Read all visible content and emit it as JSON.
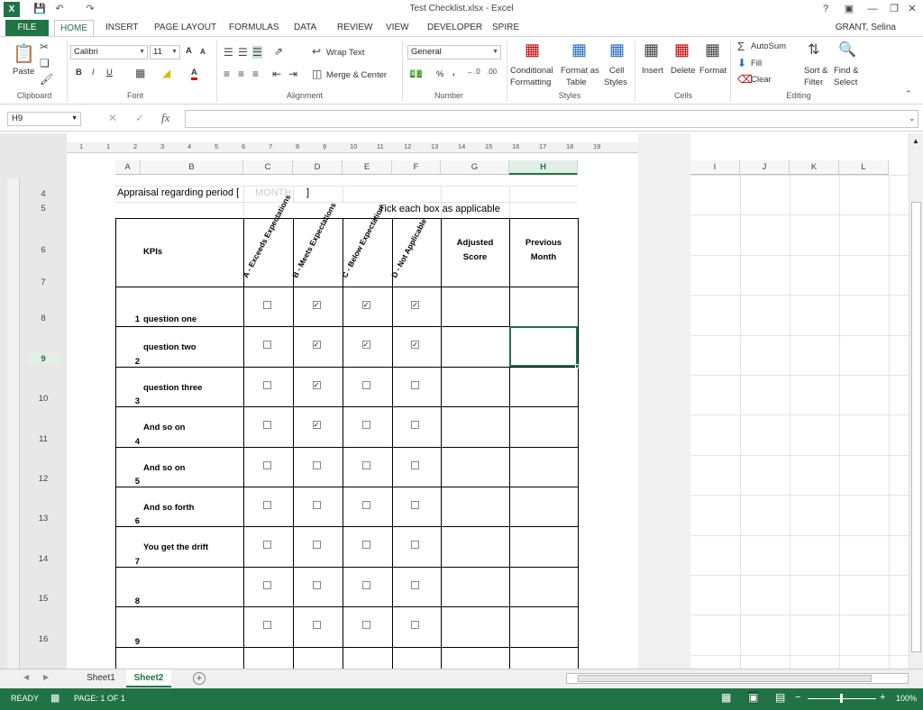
{
  "window": {
    "title": "Test Checklist.xlsx - Excel",
    "user": "GRANT, Selina",
    "help": "?",
    "logo": "X"
  },
  "tabs": [
    "FILE",
    "HOME",
    "INSERT",
    "PAGE LAYOUT",
    "FORMULAS",
    "DATA",
    "REVIEW",
    "VIEW",
    "DEVELOPER",
    "SPIRE"
  ],
  "ribbon": {
    "clipboard": {
      "paste": "Paste",
      "label": "Clipboard"
    },
    "font": {
      "name": "Calibri",
      "size": "11",
      "label": "Font",
      "bold": "B",
      "italic": "I",
      "underline": "U",
      "grow": "A",
      "shrink": "A",
      "fontcolor": "A"
    },
    "alignment": {
      "wrap": "Wrap Text",
      "merge": "Merge & Center",
      "label": "Alignment"
    },
    "number": {
      "format": "General",
      "label": "Number",
      "percent": "%",
      "comma": ","
    },
    "styles": {
      "conditional": "Conditional",
      "conditional2": "Formatting",
      "format_as": "Format as",
      "format_as2": "Table",
      "cell": "Cell",
      "cell2": "Styles",
      "label": "Styles"
    },
    "cells": {
      "insert": "Insert",
      "delete": "Delete",
      "format": "Format",
      "label": "Cells"
    },
    "editing": {
      "autosum": "AutoSum",
      "fill": "Fill",
      "clear": "Clear",
      "sort": "Sort &",
      "sort2": "Filter",
      "find": "Find &",
      "find2": "Select",
      "label": "Editing"
    }
  },
  "formula_bar": {
    "name_box": "H9",
    "fx": "fx",
    "value": ""
  },
  "columns": [
    "A",
    "B",
    "C",
    "D",
    "E",
    "F",
    "G",
    "H",
    "I",
    "J",
    "K",
    "L"
  ],
  "ruler_marks": [
    "1",
    "1",
    "2",
    "3",
    "4",
    "5",
    "6",
    "7",
    "8",
    "9",
    "10",
    "11",
    "12",
    "13",
    "14",
    "15",
    "16",
    "17",
    "18",
    "19"
  ],
  "sheet": {
    "period_label": "Appraisal regarding period [",
    "period_placeholder": "MONTH",
    "period_close": "]",
    "tick_header": "Tick each box as applicable",
    "kpi_header": "KPIs",
    "col_headers": [
      "A - Exceeds Expectations",
      "B - Meets Expectations",
      "C - Below Expectation",
      "D - Not Applicable"
    ],
    "adjusted": [
      "Adjusted",
      "Score"
    ],
    "previous": [
      "Previous",
      "Month"
    ],
    "rows": [
      {
        "num": "1",
        "row_label": "8",
        "text": "question one",
        "checks": [
          false,
          true,
          true,
          true
        ]
      },
      {
        "num": "2",
        "row_label": "9",
        "text": "question two",
        "checks": [
          false,
          true,
          true,
          true
        ]
      },
      {
        "num": "3",
        "row_label": "10",
        "text": "question three",
        "checks": [
          false,
          true,
          false,
          false
        ]
      },
      {
        "num": "4",
        "row_label": "11",
        "text": "And so on",
        "checks": [
          false,
          true,
          false,
          false
        ]
      },
      {
        "num": "5",
        "row_label": "12",
        "text": "And so on",
        "checks": [
          false,
          false,
          false,
          false
        ]
      },
      {
        "num": "6",
        "row_label": "13",
        "text": "And so forth",
        "checks": [
          false,
          false,
          false,
          false
        ]
      },
      {
        "num": "7",
        "row_label": "14",
        "text": "You get the drift",
        "checks": [
          false,
          false,
          false,
          false
        ]
      },
      {
        "num": "8",
        "row_label": "15",
        "text": "",
        "checks": [
          false,
          false,
          false,
          false
        ]
      },
      {
        "num": "9",
        "row_label": "16",
        "text": "",
        "checks": [
          false,
          false,
          false,
          false
        ]
      }
    ],
    "row_labels_top": [
      "4",
      "5",
      "6",
      "7"
    ]
  },
  "sheet_tabs": [
    "Sheet1",
    "Sheet2"
  ],
  "active_sheet": "Sheet2",
  "status": {
    "ready": "READY",
    "page": "PAGE: 1 OF 1",
    "zoom": "100%"
  },
  "colors": {
    "accent": "#217346"
  }
}
